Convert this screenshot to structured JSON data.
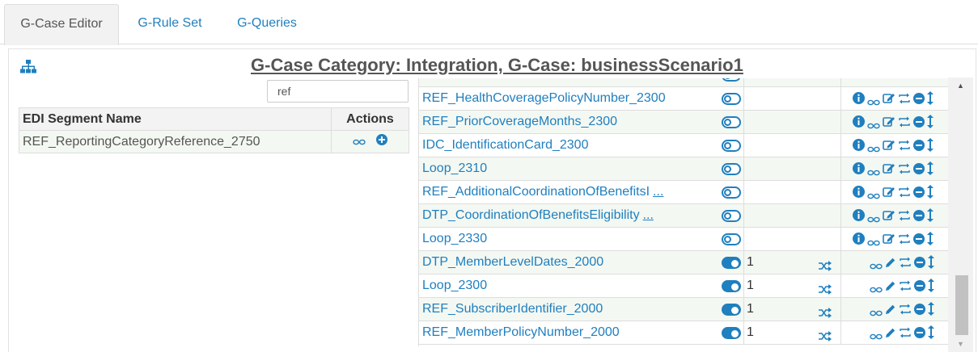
{
  "tabs": [
    {
      "label": "G-Case Editor",
      "active": true
    },
    {
      "label": "G-Rule Set",
      "active": false
    },
    {
      "label": "G-Queries",
      "active": false
    }
  ],
  "header": {
    "title": "G-Case Category: Integration, G-Case: businessScenario1",
    "tree_icon": "sitemap-icon"
  },
  "filter": {
    "value": "ref"
  },
  "segment_table": {
    "col_name": "EDI Segment Name",
    "col_actions": "Actions",
    "rows": [
      {
        "name": "REF_ReportingCategoryReference_2750",
        "action_icons": [
          "link-icon",
          "add-circle-icon"
        ]
      }
    ]
  },
  "segment_list": [
    {
      "name": "REF_HealthCoveragePolicyNumber_2300",
      "more": "",
      "enabled": false,
      "count": "",
      "icons": [
        "info-icon",
        "link-icon",
        "edit-icon",
        "swap-icon",
        "remove-icon",
        "move-icon"
      ]
    },
    {
      "name": "REF_PriorCoverageMonths_2300",
      "more": "",
      "enabled": false,
      "count": "",
      "icons": [
        "info-icon",
        "link-icon",
        "edit-icon",
        "swap-icon",
        "remove-icon",
        "move-icon"
      ]
    },
    {
      "name": "IDC_IdentificationCard_2300",
      "more": "",
      "enabled": false,
      "count": "",
      "icons": [
        "info-icon",
        "link-icon",
        "edit-icon",
        "swap-icon",
        "remove-icon",
        "move-icon"
      ]
    },
    {
      "name": "Loop_2310",
      "more": "",
      "enabled": false,
      "count": "",
      "icons": [
        "info-icon",
        "link-icon",
        "edit-icon",
        "swap-icon",
        "remove-icon",
        "move-icon"
      ]
    },
    {
      "name": "REF_AdditionalCoordinationOfBenefitsI",
      "more": "...",
      "enabled": false,
      "count": "",
      "icons": [
        "info-icon",
        "link-icon",
        "edit-icon",
        "swap-icon",
        "remove-icon",
        "move-icon"
      ]
    },
    {
      "name": "DTP_CoordinationOfBenefitsEligibility",
      "more": "...",
      "enabled": false,
      "count": "",
      "icons": [
        "info-icon",
        "link-icon",
        "edit-icon",
        "swap-icon",
        "remove-icon",
        "move-icon"
      ]
    },
    {
      "name": "Loop_2330",
      "more": "",
      "enabled": false,
      "count": "",
      "icons": [
        "info-icon",
        "link-icon",
        "edit-icon",
        "swap-icon",
        "remove-icon",
        "move-icon"
      ]
    },
    {
      "name": "DTP_MemberLevelDates_2000",
      "more": "",
      "enabled": true,
      "count": "1",
      "icons": [
        "link-icon",
        "pencil-icon",
        "swap-icon",
        "remove-icon",
        "move-icon"
      ]
    },
    {
      "name": "Loop_2300",
      "more": "",
      "enabled": true,
      "count": "1",
      "icons": [
        "link-icon",
        "pencil-icon",
        "swap-icon",
        "remove-icon",
        "move-icon"
      ]
    },
    {
      "name": "REF_SubscriberIdentifier_2000",
      "more": "",
      "enabled": true,
      "count": "1",
      "icons": [
        "link-icon",
        "pencil-icon",
        "swap-icon",
        "remove-icon",
        "move-icon"
      ]
    },
    {
      "name": "REF_MemberPolicyNumber_2000",
      "more": "",
      "enabled": true,
      "count": "1",
      "icons": [
        "link-icon",
        "pencil-icon",
        "swap-icon",
        "remove-icon",
        "move-icon"
      ]
    }
  ],
  "colors": {
    "accent": "#1f7fbf",
    "row_alt": "#f4f8f2",
    "border": "#dddddd"
  }
}
